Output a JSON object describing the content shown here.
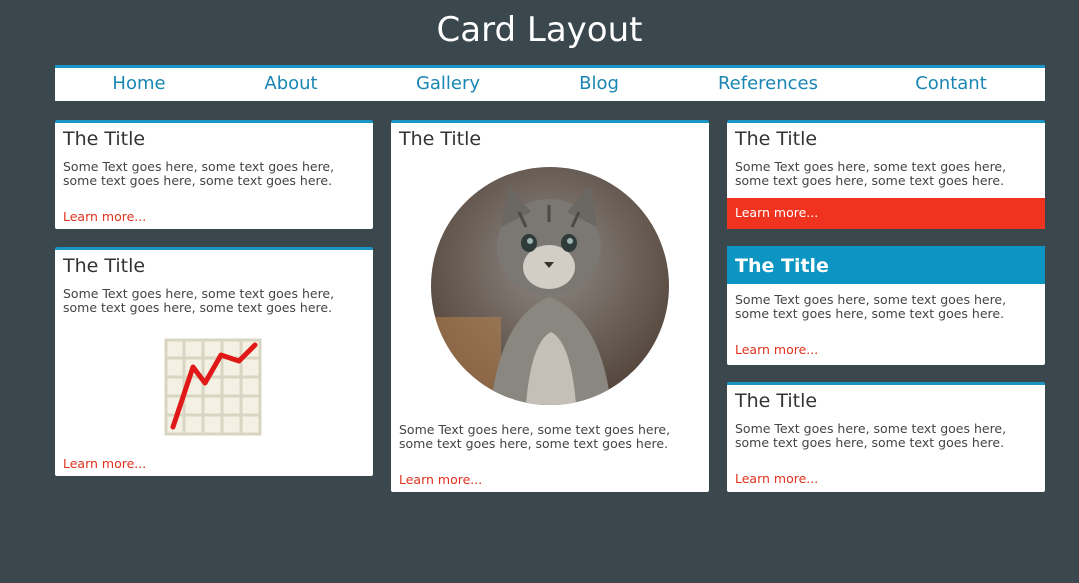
{
  "header": {
    "title": "Card Layout"
  },
  "nav": {
    "items": [
      "Home",
      "About",
      "Gallery",
      "Blog",
      "References",
      "Contant"
    ]
  },
  "card": {
    "title": "The Title",
    "text_line1": "Some Text goes here, some text goes here,",
    "text_line2": "some text goes here, some text goes here.",
    "link": "Learn more..."
  },
  "colors": {
    "background": "#3a474d",
    "accent": "#1a94c4",
    "link": "#e0321e",
    "highlight_bar": "#f0331f",
    "title_bar": "#0c95c2"
  },
  "icons": {
    "chart": "line-chart-icon",
    "image": "kitten-photo"
  }
}
